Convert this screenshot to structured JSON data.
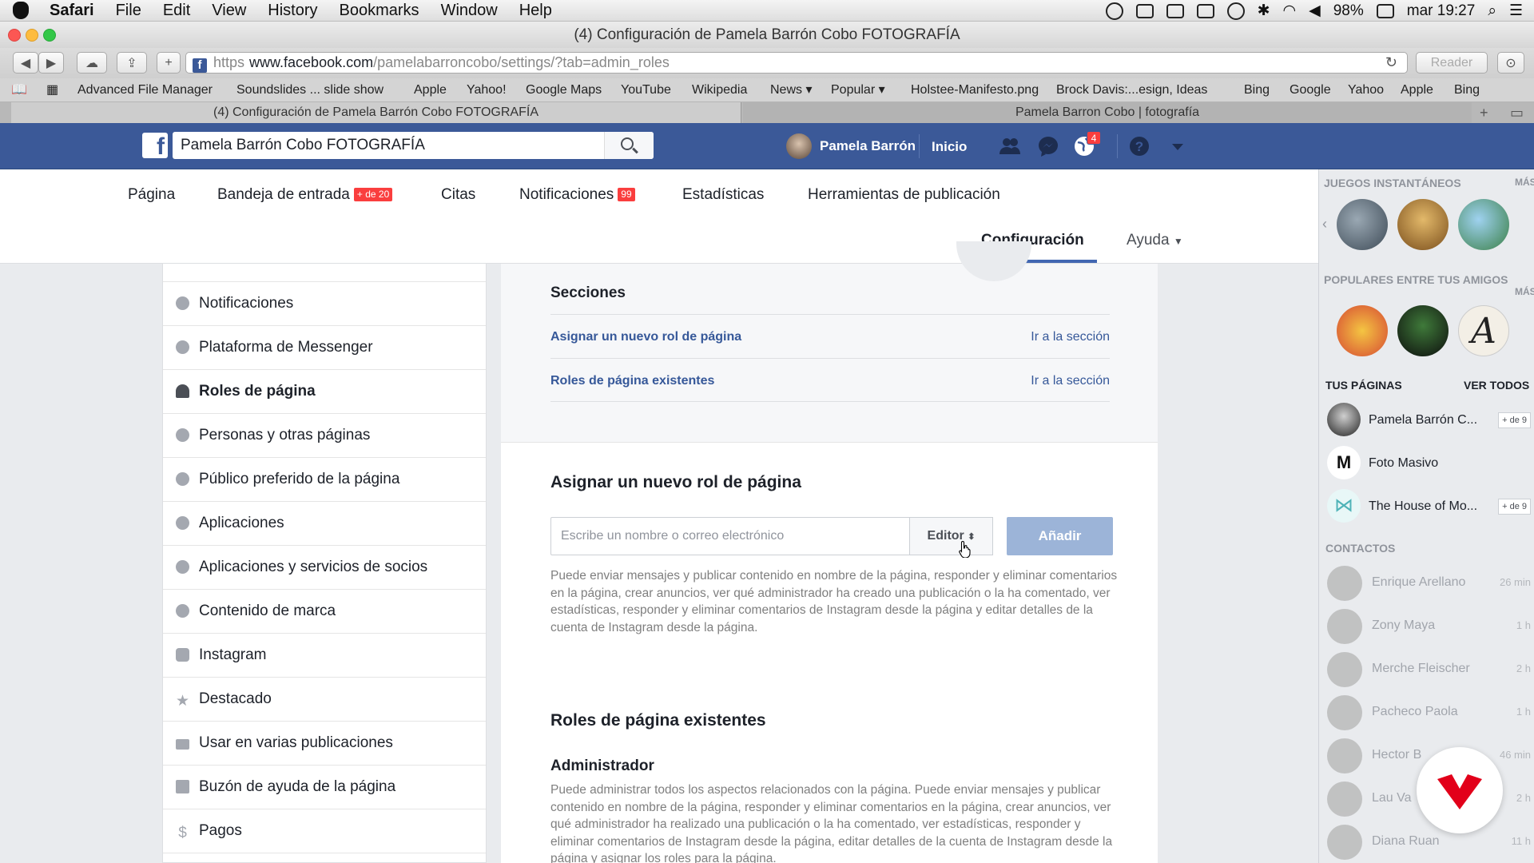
{
  "mac_menu": {
    "app_name": "Safari",
    "items": [
      "File",
      "Edit",
      "View",
      "History",
      "Bookmarks",
      "Window",
      "Help"
    ],
    "battery": "98%",
    "clock": "mar 19:27"
  },
  "window": {
    "title": "(4) Configuración de Pamela Barrón Cobo FOTOGRAFÍA"
  },
  "toolbar": {
    "url_scheme": "https",
    "url_domain": "www.facebook.com",
    "url_path": "/pamelabarroncobo/settings/?tab=admin_roles",
    "reader_label": "Reader"
  },
  "bookmarks": [
    "Advanced File Manager",
    "Soundslides ... slide show",
    "Apple",
    "Yahoo!",
    "Google Maps",
    "YouTube",
    "Wikipedia",
    "News",
    "Popular",
    "Holstee-Manifesto.png",
    "Brock Davis:...esign, Ideas",
    "Bing",
    "Google",
    "Yahoo",
    "Apple",
    "Bing"
  ],
  "tabs": [
    {
      "label": "(4) Configuración de Pamela Barrón Cobo FOTOGRAFÍA"
    },
    {
      "label": "Pamela Barron Cobo | fotografía"
    }
  ],
  "fb_header": {
    "search_value": "Pamela Barrón Cobo FOTOGRAFÍA",
    "user_name": "Pamela Barrón",
    "home_label": "Inicio",
    "notifications_count": "4",
    "brand_color": "#3b5998"
  },
  "page_nav": {
    "items": [
      {
        "label": "Página"
      },
      {
        "label": "Bandeja de entrada",
        "badge": "+ de 20"
      },
      {
        "label": "Citas"
      },
      {
        "label": "Notificaciones",
        "badge": "99"
      },
      {
        "label": "Estadísticas"
      },
      {
        "label": "Herramientas de publicación"
      }
    ],
    "config_label": "Configuración",
    "help_label": "Ayuda"
  },
  "left_menu": [
    {
      "label": "Notificaciones",
      "icon": "globe-icon"
    },
    {
      "label": "Plataforma de Messenger",
      "icon": "messenger-icon"
    },
    {
      "label": "Roles de página",
      "icon": "person-icon",
      "active": true
    },
    {
      "label": "Personas y otras páginas",
      "icon": "people-icon"
    },
    {
      "label": "Público preferido de la página",
      "icon": "people-icon"
    },
    {
      "label": "Aplicaciones",
      "icon": "cube-icon"
    },
    {
      "label": "Aplicaciones y servicios de socios",
      "icon": "cube-icon"
    },
    {
      "label": "Contenido de marca",
      "icon": "handshake-icon"
    },
    {
      "label": "Instagram",
      "icon": "instagram-icon"
    },
    {
      "label": "Destacado",
      "icon": "star-icon"
    },
    {
      "label": "Usar en varias publicaciones",
      "icon": "video-icon"
    },
    {
      "label": "Buzón de ayuda de la página",
      "icon": "facebook-icon"
    },
    {
      "label": "Pagos",
      "icon": "dollar-icon"
    }
  ],
  "sections": {
    "title": "Secciones",
    "rows": [
      {
        "label": "Asignar un nuevo rol de página",
        "link": "Ir a la sección"
      },
      {
        "label": "Roles de página existentes",
        "link": "Ir a la sección"
      }
    ]
  },
  "assign": {
    "title": "Asignar un nuevo rol de página",
    "input_placeholder": "Escribe un nombre o correo electrónico",
    "role_value": "Editor",
    "add_label": "Añadir",
    "help_text": "Puede enviar mensajes y publicar contenido en nombre de la página, responder y eliminar comentarios en la página, crear anuncios, ver qué administrador ha creado una publicación o la ha comentado, ver estadísticas, responder y eliminar comentarios de Instagram desde la página y editar detalles de la cuenta de Instagram desde la página."
  },
  "existing": {
    "title": "Roles de página existentes",
    "admin_title": "Administrador",
    "admin_text": "Puede administrar todos los aspectos relacionados con la página. Puede enviar mensajes y publicar contenido en nombre de la página, responder y eliminar comentarios en la página, crear anuncios, ver qué administrador ha realizado una publicación o la ha comentado, ver estadísticas, responder y eliminar comentarios de Instagram desde la página, editar detalles de la cuenta de Instagram desde la página y asignar los roles para la página."
  },
  "right_sidebar": {
    "games_title": "JUEGOS INSTANTÁNEOS",
    "more_label": "MÁS",
    "popular_title": "POPULARES ENTRE TUS AMIGOS",
    "pages_title": "TUS PÁGINAS",
    "see_all_label": "VER TODOS",
    "pages": [
      {
        "name": "Pamela Barrón C...",
        "badge": "+ de 9"
      },
      {
        "name": "Foto Masivo",
        "badge": ""
      },
      {
        "name": "The House of Mo...",
        "badge": "+ de 9"
      }
    ],
    "contacts_title": "CONTACTOS",
    "contacts": [
      {
        "name": "Enrique Arellano",
        "time": "26 min"
      },
      {
        "name": "Zony Maya",
        "time": "1 h"
      },
      {
        "name": "Merche Fleischer",
        "time": "2 h"
      },
      {
        "name": "Pacheco Paola",
        "time": "1 h"
      },
      {
        "name": "Hector B",
        "time": "46 min"
      },
      {
        "name": "Lau Va",
        "time": "2 h"
      },
      {
        "name": "Diana Ruan",
        "time": "11 h"
      }
    ]
  }
}
